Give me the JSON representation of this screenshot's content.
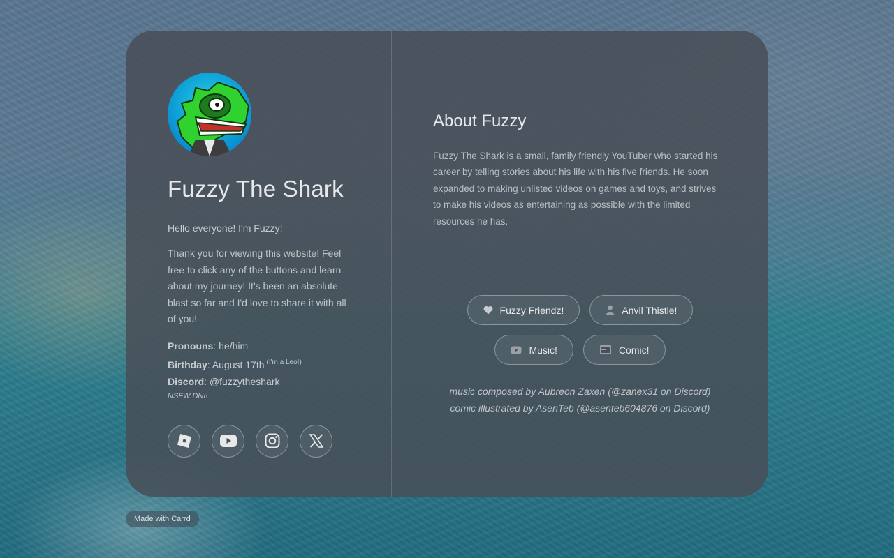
{
  "profile": {
    "name": "Fuzzy The Shark",
    "hello": "Hello everyone! I'm Fuzzy!",
    "intro": "Thank you for viewing this website! Feel free to click any of the buttons and learn about my journey! It's been an absolute blast so far and I'd love to share it with all of you!",
    "pronouns_label": "Pronouns",
    "pronouns_value": ": he/him",
    "birthday_label": "Birthday",
    "birthday_value": ": August 17th",
    "birthday_note": "(I'm a Leo!)",
    "discord_label": "Discord",
    "discord_value": ": @fuzzytheshark",
    "nsfw": "NSFW DNI!"
  },
  "socials": [
    {
      "icon": "roblox-icon"
    },
    {
      "icon": "youtube-icon"
    },
    {
      "icon": "instagram-icon"
    },
    {
      "icon": "x-icon"
    }
  ],
  "about": {
    "title": "About Fuzzy",
    "text": "Fuzzy The Shark is a small, family friendly YouTuber who started his career by telling stories about his life with his five friends. He soon expanded to making unlisted videos on games and toys, and strives to make his videos as entertaining as possible with the limited resources he has."
  },
  "buttons": [
    {
      "label": "Fuzzy Friendz!",
      "icon": "heart-icon"
    },
    {
      "label": "Anvil Thistle!",
      "icon": "person-icon"
    },
    {
      "label": "Music!",
      "icon": "youtube-icon"
    },
    {
      "label": "Comic!",
      "icon": "comic-icon"
    }
  ],
  "credits": {
    "music": "music composed by Aubreon Zaxen (@zanex31 on Discord)",
    "comic": "comic illustrated by AsenTeb (@asenteb604876 on Discord)"
  },
  "footer": {
    "made_with": "Made with Carrd"
  }
}
